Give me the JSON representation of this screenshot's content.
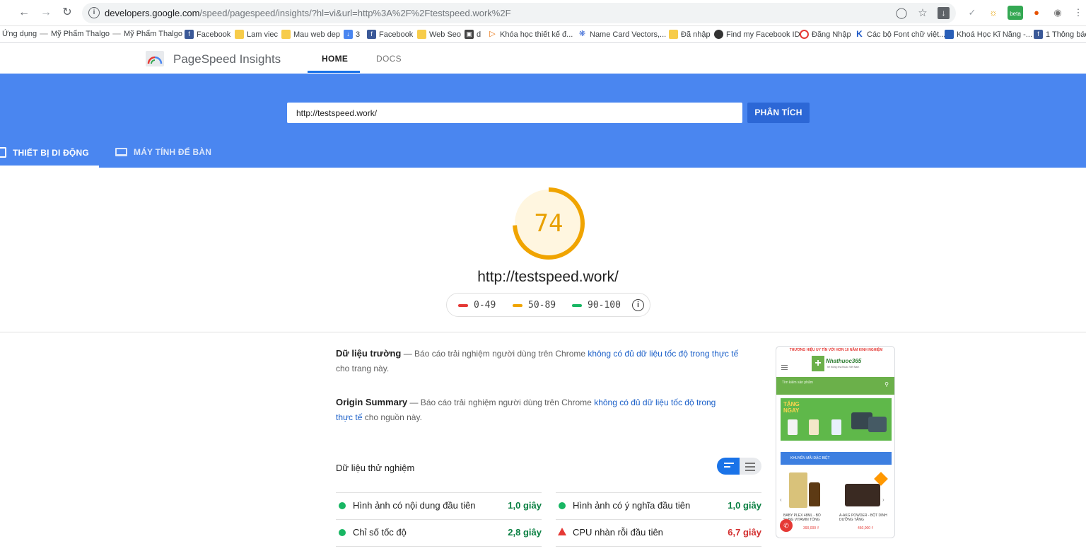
{
  "browser": {
    "url_host": "developers.google.com",
    "url_rest": "/speed/pagespeed/insights/?hl=vi&url=http%3A%2F%2Ftestspeed.work%2F",
    "extension_badge": "beta"
  },
  "bookmarks": [
    {
      "label": "Ứng dụng"
    },
    {
      "label": "Mỹ Phẩm Thalgo"
    },
    {
      "label": "Mỹ Phẩm Thalgo"
    },
    {
      "label": "Facebook"
    },
    {
      "label": "Lam viec"
    },
    {
      "label": "Mau web dep"
    },
    {
      "label": "3"
    },
    {
      "label": "Facebook"
    },
    {
      "label": "Web Seo"
    },
    {
      "label": "d"
    },
    {
      "label": "Khóa học thiết kế đ..."
    },
    {
      "label": "Name Card Vectors,..."
    },
    {
      "label": "Đã nhập"
    },
    {
      "label": "Find my Facebook ID"
    },
    {
      "label": "Đăng Nhập"
    },
    {
      "label": "Các bộ Font chữ việt..."
    },
    {
      "label": "Khoá Học Kĩ Năng -..."
    },
    {
      "label": "1 Thông bác"
    }
  ],
  "psi": {
    "title": "PageSpeed Insights",
    "tabs": [
      {
        "label": "HOME"
      },
      {
        "label": "DOCS"
      }
    ],
    "search": {
      "value": "http://testspeed.work/",
      "button": "PHÂN TÍCH"
    },
    "device_tabs": [
      {
        "label": "THIẾT BỊ DI ĐỘNG"
      },
      {
        "label": "MÁY TÍNH ĐỂ BÀN"
      }
    ],
    "score": {
      "value": "74",
      "fraction": 0.74,
      "color": "#f0a400"
    },
    "tested_url": "http://testspeed.work/",
    "legend": [
      {
        "label": "0-49",
        "color": "#e53935"
      },
      {
        "label": "50-89",
        "color": "#f0a400"
      },
      {
        "label": "90-100",
        "color": "#18b663"
      }
    ]
  },
  "field_data": {
    "heading": "Dữ liệu trường",
    "dash": " — Báo cáo trải nghiệm người dùng trên Chrome ",
    "link": "không có đủ dữ liệu tốc độ trong thực tế",
    "tail": " cho trang này."
  },
  "origin_summary": {
    "heading": "Origin Summary",
    "dash": " — Báo cáo trải nghiệm người dùng trên Chrome ",
    "link": "không có đủ dữ liệu tốc độ trong thực tế",
    "tail": " cho nguồn này."
  },
  "lab": {
    "title": "Dữ liệu thử nghiệm",
    "metrics": [
      {
        "label": "Hình ảnh có nội dung đầu tiên",
        "value": "1,0 giây",
        "status": "good",
        "color": "#0b8043"
      },
      {
        "label": "Hình ảnh có ý nghĩa đầu tiên",
        "value": "1,0 giây",
        "status": "good",
        "color": "#0b8043"
      },
      {
        "label": "Chỉ số tốc độ",
        "value": "2,8 giây",
        "status": "good",
        "color": "#0b8043"
      },
      {
        "label": "CPU nhàn rỗi đầu tiên",
        "value": "6,7 giây",
        "status": "poor",
        "color": "#d32f2f"
      }
    ]
  },
  "preview": {
    "top_banner": "THƯƠNG HIỆU UY TÍN VỚI HƠN 10 NĂM KINH NGHIỆM",
    "logo": "Nhathuoc365",
    "logo_sub": "hệ thống nhà thuốc Việt Nam",
    "search_placeholder": "Tìm kiếm sản phẩm",
    "banner_text": "TẶNG NGAY",
    "promo_label": "KHUYẾN MÃI ĐẶC BIỆT",
    "products": [
      {
        "name": "BABY PLEX 48ML - BỔ SUNG VITAMIN TỔNG",
        "price": "390,000 ₫"
      },
      {
        "name": "A-AKG POWDER - BỘT DINH DƯỠNG TĂNG",
        "price": "450,000 ₫"
      }
    ]
  }
}
